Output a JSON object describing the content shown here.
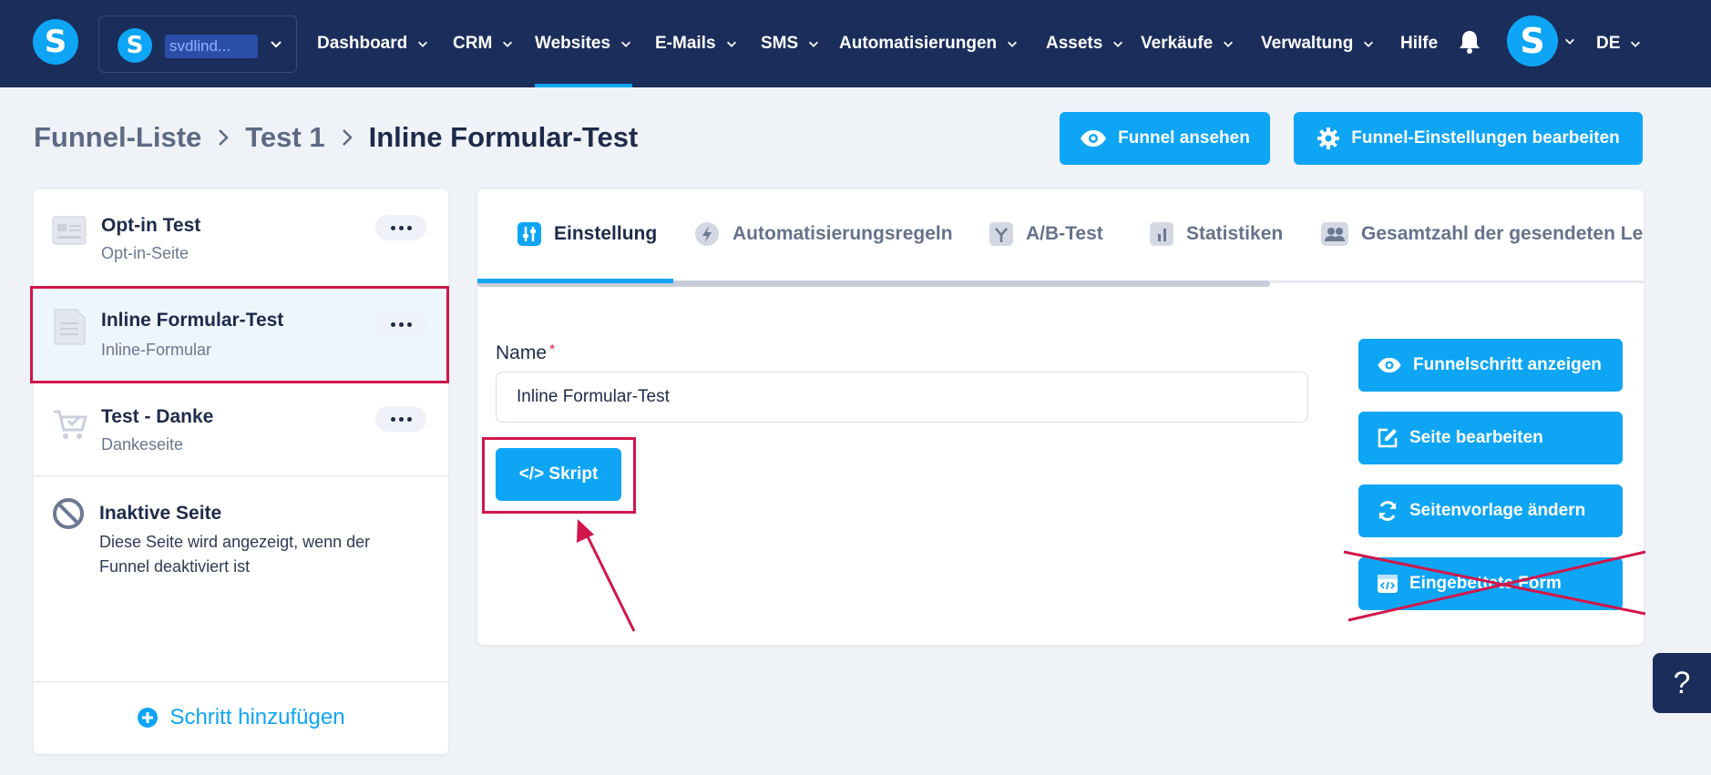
{
  "nav": {
    "logo_letter": "S",
    "account": {
      "logo_letter": "S",
      "name": "svdlind..."
    },
    "items": [
      {
        "label": "Dashboard"
      },
      {
        "label": "CRM"
      },
      {
        "label": "Websites",
        "active": true
      },
      {
        "label": "E-Mails"
      },
      {
        "label": "SMS"
      },
      {
        "label": "Automatisierungen"
      },
      {
        "label": "Assets"
      },
      {
        "label": "Verkäufe"
      },
      {
        "label": "Verwaltung"
      },
      {
        "label": "Hilfe"
      }
    ],
    "user_letter": "S",
    "language": "DE"
  },
  "breadcrumb": [
    "Funnel-Liste",
    "Test 1",
    "Inline Formular-Test"
  ],
  "header_buttons": {
    "view_funnel": "Funnel ansehen",
    "edit_settings": "Funnel-Einstellungen bearbeiten"
  },
  "steps": [
    {
      "title": "Opt-in Test",
      "subtitle": "Opt-in-Seite",
      "icon": "optin-page-icon"
    },
    {
      "title": "Inline Formular-Test",
      "subtitle": "Inline-Formular",
      "icon": "inline-form-icon",
      "selected": true
    },
    {
      "title": "Test - Danke",
      "subtitle": "Dankeseite",
      "icon": "thankyou-cart-icon"
    }
  ],
  "inactive_page": {
    "title": "Inaktive Seite",
    "description": "Diese Seite wird angezeigt, wenn der Funnel deaktiviert ist"
  },
  "add_step_label": "Schritt hinzufügen",
  "tabs": [
    {
      "label": "Einstellung",
      "active": true
    },
    {
      "label": "Automatisierungsregeln"
    },
    {
      "label": "A/B-Test"
    },
    {
      "label": "Statistiken"
    },
    {
      "label": "Gesamtzahl der gesendeten Le"
    }
  ],
  "form": {
    "name_label": "Name",
    "required_mark": "*",
    "name_value": "Inline Formular-Test",
    "script_button": "</> Skript"
  },
  "side_buttons": {
    "show_step": "Funnelschritt anzeigen",
    "edit_page": "Seite bearbeiten",
    "change_template": "Seitenvorlage ändern",
    "embedded_form": "Eingebettete Form"
  },
  "help_label": "?",
  "colors": {
    "nav_bg": "#1b2d5b",
    "accent": "#0ea5f5",
    "annotation": "#d0164a",
    "page_bg": "#eff2f7"
  }
}
